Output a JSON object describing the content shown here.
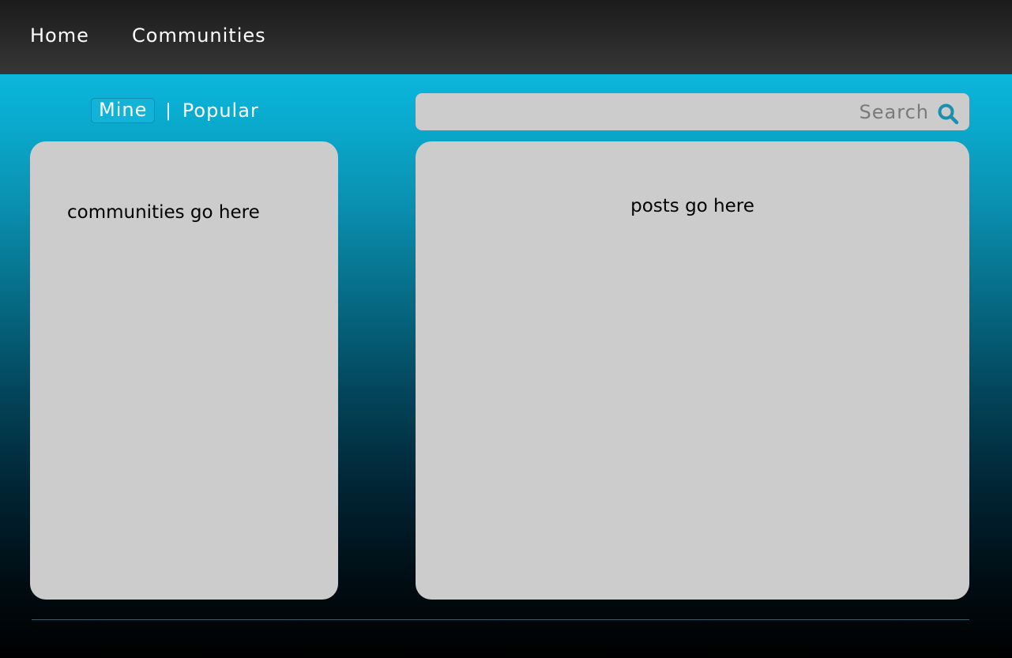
{
  "nav": {
    "home_label": "Home",
    "communities_label": "Communities"
  },
  "filter": {
    "mine_label": "Mine",
    "separator": "|",
    "popular_label": "Popular",
    "selected": "Mine"
  },
  "search": {
    "placeholder": "Search",
    "value": "",
    "icon": "search-icon"
  },
  "communities_panel": {
    "placeholder_text": "communities go here"
  },
  "posts_panel": {
    "placeholder_text": "posts go here"
  },
  "colors": {
    "nav_background": "#2a2a2a",
    "accent": "#12b3d6",
    "panel_background": "#cccccc",
    "search_icon": "#1a8fb0"
  }
}
